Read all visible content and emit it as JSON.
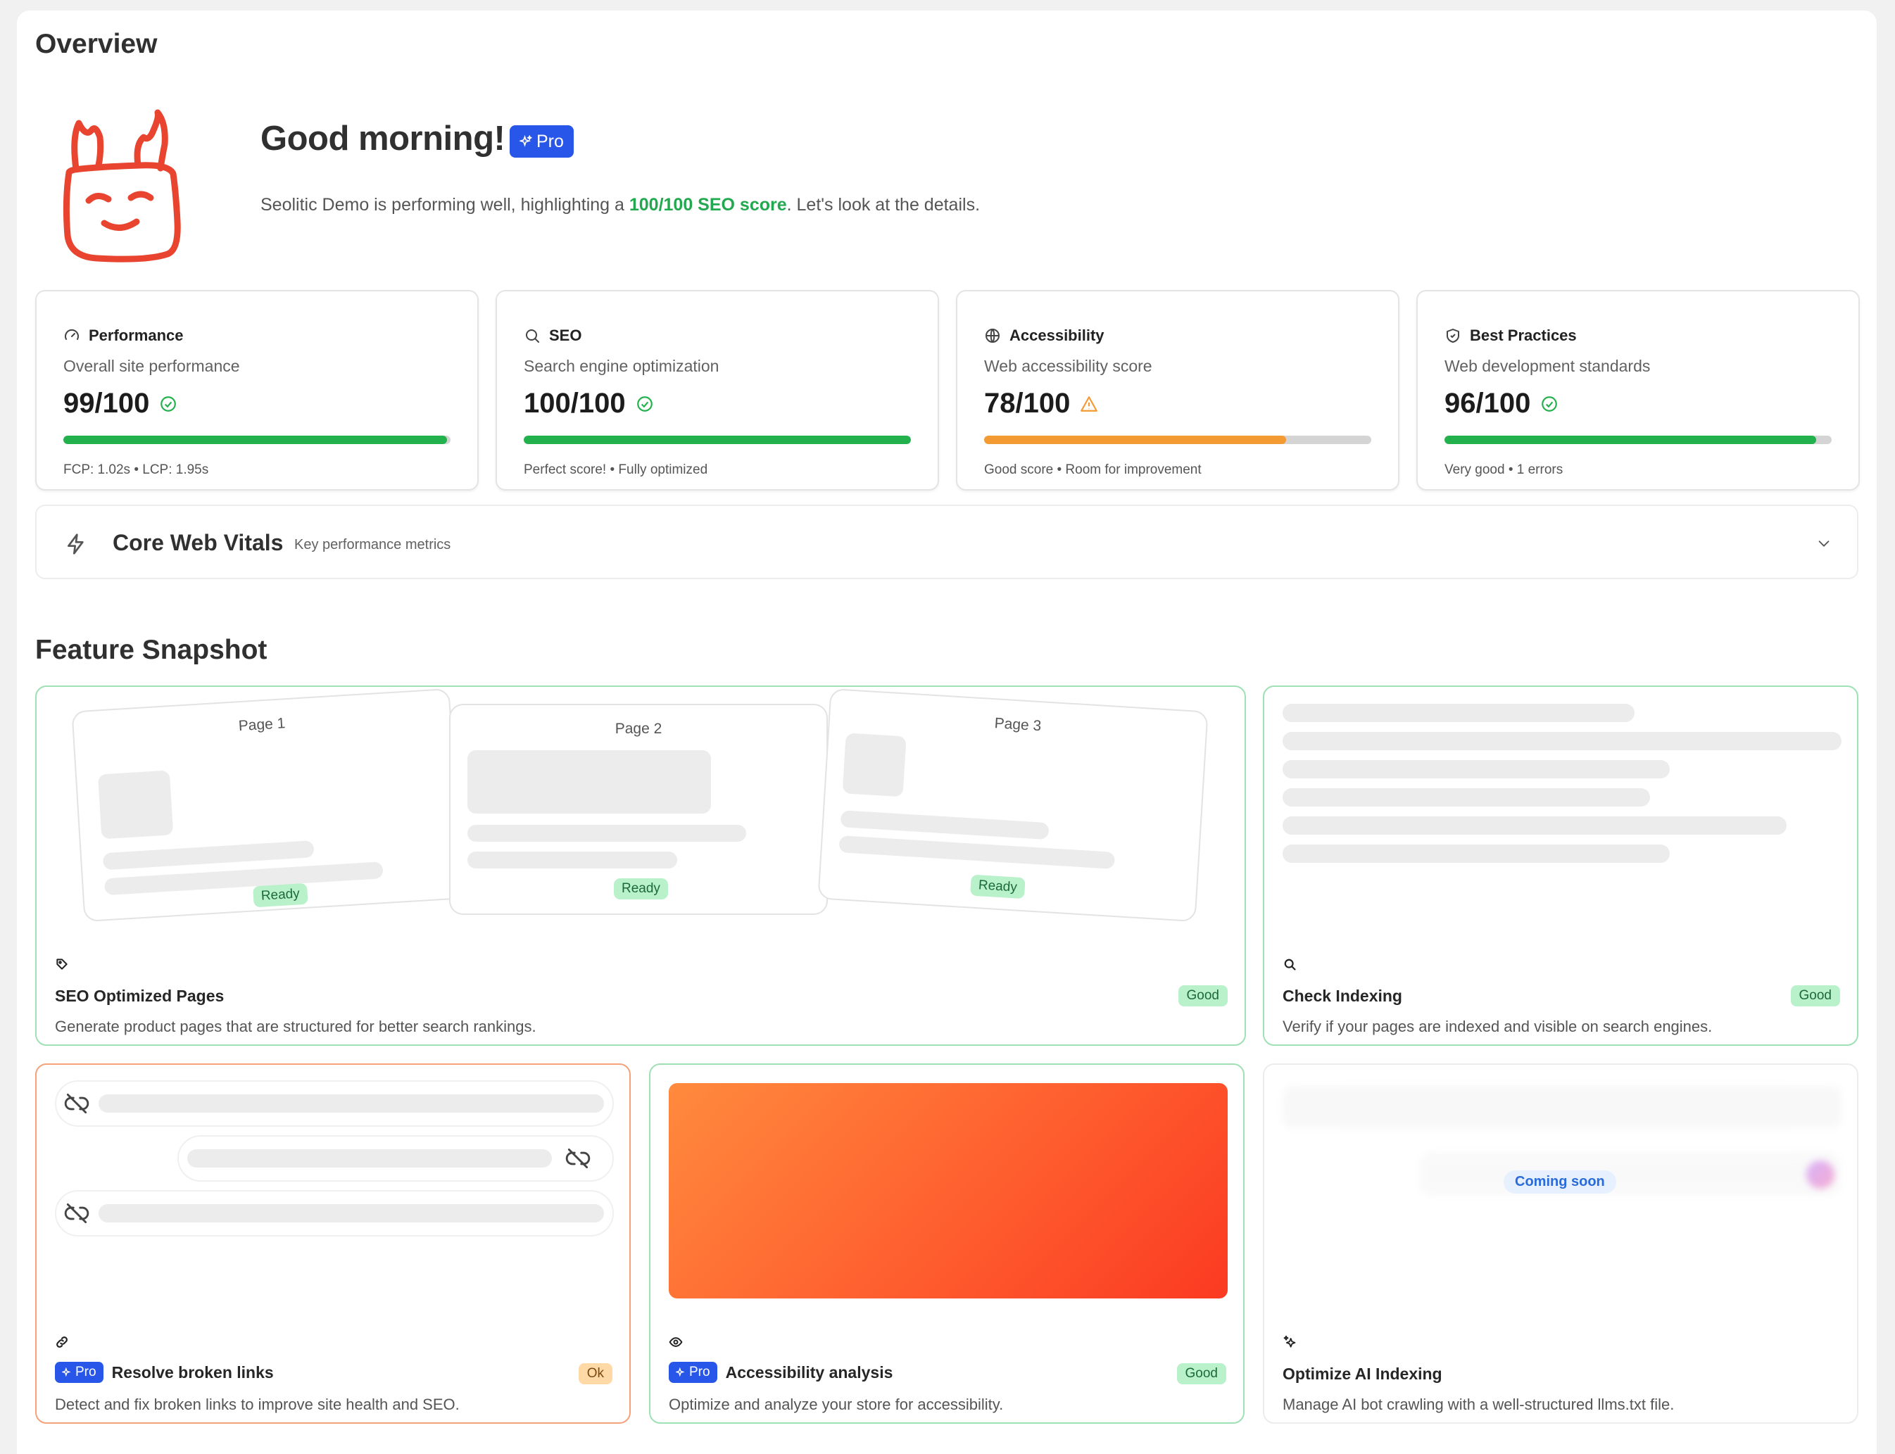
{
  "page": {
    "title": "Overview"
  },
  "hero": {
    "greeting": "Good morning!",
    "pro_label": "Pro",
    "desc_prefix": "Seolitic Demo is performing well, highlighting a ",
    "desc_highlight": "100/100 SEO score",
    "desc_suffix": ". Let's look at the details."
  },
  "score_cards": [
    {
      "title": "Performance",
      "icon": "gauge-icon",
      "subtitle": "Overall site performance",
      "score": "99/100",
      "status_icon": "check-circle-icon",
      "progress": 0.99,
      "bar_color": "#22b14c",
      "meta": "FCP: 1.02s  •  LCP: 1.95s"
    },
    {
      "title": "SEO",
      "icon": "search-icon",
      "subtitle": "Search engine optimization",
      "score": "100/100",
      "status_icon": "check-circle-icon",
      "progress": 1.0,
      "bar_color": "#22b14c",
      "meta": "Perfect score! • Fully optimized"
    },
    {
      "title": "Accessibility",
      "icon": "globe-icon",
      "subtitle": "Web accessibility score",
      "score": "78/100",
      "status_icon": "warning-icon",
      "progress": 0.78,
      "bar_color": "#f39a33",
      "meta": "Good score • Room for improvement"
    },
    {
      "title": "Best Practices",
      "icon": "shield-check-icon",
      "subtitle": "Web development standards",
      "score": "96/100",
      "status_icon": "check-circle-icon",
      "progress": 0.96,
      "bar_color": "#22b14c",
      "meta": "Very good • 1 errors"
    }
  ],
  "core_web_vitals": {
    "title": "Core Web Vitals",
    "subtitle": "Key performance metrics",
    "icon": "bolt-icon"
  },
  "features": {
    "title": "Feature Snapshot",
    "seo_pages": {
      "title": "SEO Optimized Pages",
      "desc": "Generate product pages that are structured for better search rankings.",
      "status": "Good",
      "pages": [
        {
          "label": "Page 1",
          "badge": "Ready"
        },
        {
          "label": "Page 2",
          "badge": "Ready"
        },
        {
          "label": "Page 3",
          "badge": "Ready"
        }
      ]
    },
    "check_indexing": {
      "title": "Check Indexing",
      "desc": "Verify if your pages are indexed and visible on search engines.",
      "status": "Good"
    },
    "broken_links": {
      "pro": "Pro",
      "title": "Resolve broken links",
      "desc": "Detect and fix broken links to improve site health and SEO.",
      "status": "Ok"
    },
    "accessibility": {
      "pro": "Pro",
      "title": "Accessibility analysis",
      "desc": "Optimize and analyze your store for accessibility.",
      "status": "Good"
    },
    "ai_indexing": {
      "title": "Optimize AI Indexing",
      "desc": "Manage AI bot crawling with a well-structured llms.txt file.",
      "coming_soon": "Coming soon"
    }
  }
}
